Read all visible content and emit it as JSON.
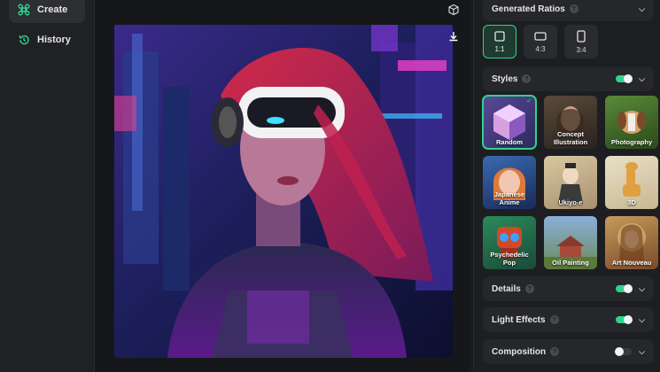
{
  "sidebar": {
    "items": [
      {
        "label": "Create",
        "icon": "command-icon",
        "active": true
      },
      {
        "label": "History",
        "icon": "history-icon",
        "active": false
      }
    ]
  },
  "canvas": {
    "top_icons": [
      "cube-icon",
      "download-icon"
    ]
  },
  "panel": {
    "ratios": {
      "title": "Generated Ratios",
      "options": [
        {
          "label": "1:1",
          "active": true
        },
        {
          "label": "4:3",
          "active": false
        },
        {
          "label": "3:4",
          "active": false
        }
      ]
    },
    "styles": {
      "title": "Styles",
      "enabled": true,
      "items": [
        {
          "label": "Random",
          "active": true
        },
        {
          "label": "Concept Illustration",
          "active": false
        },
        {
          "label": "Photography",
          "active": false
        },
        {
          "label": "Japanese Anime",
          "active": false
        },
        {
          "label": "Ukiyo-e",
          "active": false
        },
        {
          "label": "3D",
          "active": false
        },
        {
          "label": "Psychedelic Pop",
          "active": false
        },
        {
          "label": "Oil Painting",
          "active": false
        },
        {
          "label": "Art Nouveau",
          "active": false
        }
      ]
    },
    "details": {
      "title": "Details",
      "enabled": true
    },
    "light_effects": {
      "title": "Light Effects",
      "enabled": true
    },
    "composition": {
      "title": "Composition",
      "enabled": false
    }
  },
  "colors": {
    "accent": "#2fd38e",
    "bg": "#1a1b1e",
    "panel": "#26272b"
  }
}
